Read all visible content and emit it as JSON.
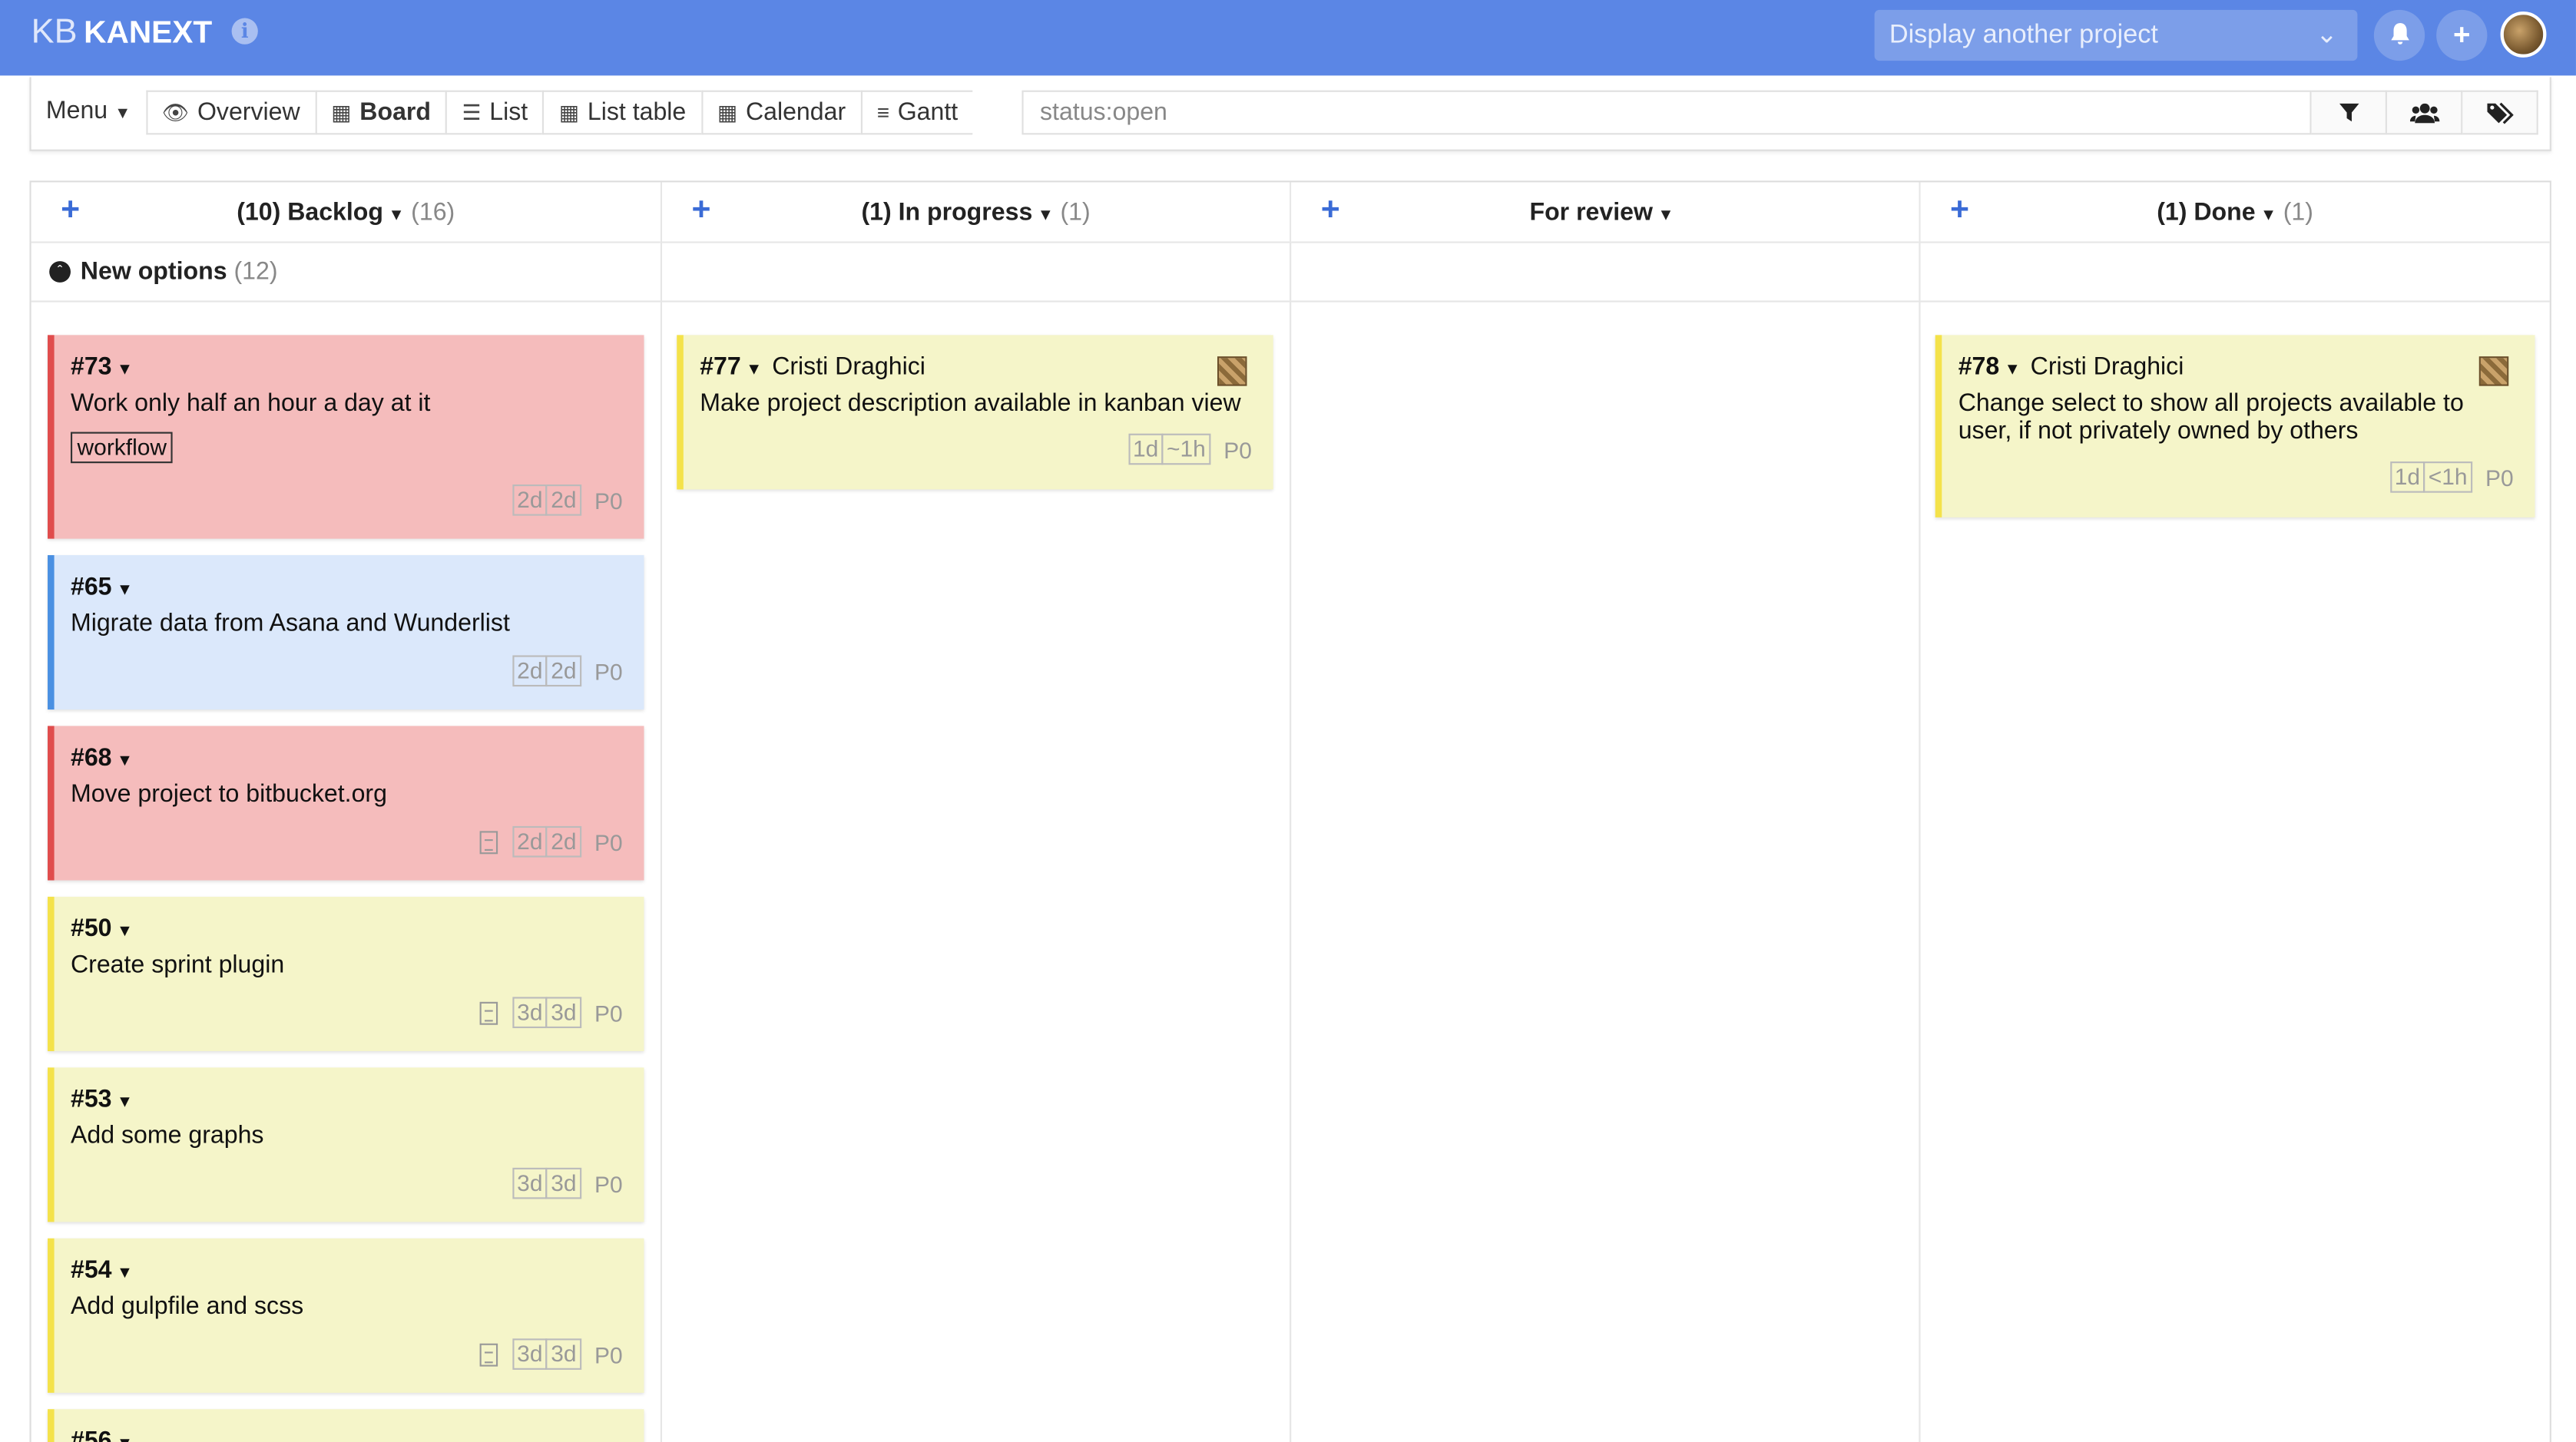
{
  "app": {
    "logo_prefix": "KB",
    "name": "KANEXT",
    "info_icon": "info-icon",
    "accent": "#5b86e5"
  },
  "header": {
    "project_selector": "Display another project",
    "icons": [
      "bell-icon",
      "plus-icon",
      "avatar"
    ]
  },
  "toolbar": {
    "menu_label": "Menu",
    "views": [
      {
        "label": "Overview",
        "icon": "eye-icon"
      },
      {
        "label": "Board",
        "icon": "grid-icon"
      },
      {
        "label": "List",
        "icon": "list-icon"
      },
      {
        "label": "List table",
        "icon": "table-icon"
      },
      {
        "label": "Calendar",
        "icon": "calendar-icon"
      },
      {
        "label": "Gantt",
        "icon": "sliders-icon"
      }
    ],
    "active_view": "Board",
    "search_value": "status:open",
    "filter_icons": [
      "filter-icon",
      "users-icon",
      "tags-icon"
    ]
  },
  "columns": [
    {
      "title": "(10) Backlog",
      "count": "(16)"
    },
    {
      "title": "(1) In progress",
      "count": "(1)"
    },
    {
      "title": "For review",
      "count": ""
    },
    {
      "title": "(1) Done",
      "count": "(1)"
    }
  ],
  "swimlane": {
    "title": "New options",
    "count": "(12)"
  },
  "cards": {
    "backlog": [
      {
        "id": "#73",
        "title": "Work only half an hour a day at it",
        "tag": "workflow",
        "est1": "2d",
        "est2": "2d",
        "priority": "P0",
        "color": "red"
      },
      {
        "id": "#65",
        "title": "Migrate data from Asana and Wunderlist",
        "est1": "2d",
        "est2": "2d",
        "priority": "P0",
        "color": "blue"
      },
      {
        "id": "#68",
        "title": "Move project to bitbucket.org",
        "est1": "2d",
        "est2": "2d",
        "priority": "P0",
        "color": "red"
      },
      {
        "id": "#50",
        "title": "Create sprint plugin",
        "est1": "3d",
        "est2": "3d",
        "priority": "P0",
        "color": "yellow"
      },
      {
        "id": "#53",
        "title": "Add some graphs",
        "est1": "3d",
        "est2": "3d",
        "priority": "P0",
        "color": "yellow"
      },
      {
        "id": "#54",
        "title": "Add gulpfile and scss",
        "est1": "3d",
        "est2": "3d",
        "priority": "P0",
        "color": "yellow"
      },
      {
        "id": "#56",
        "color": "yellow"
      }
    ],
    "in_progress": [
      {
        "id": "#77",
        "owner": "Cristi Draghici",
        "title": "Make project description available in kanban view",
        "est1": "1d",
        "est2": "~1h",
        "priority": "P0",
        "color": "yellow"
      }
    ],
    "done": [
      {
        "id": "#78",
        "owner": "Cristi Draghici",
        "title": "Change select to show all projects available to user, if not privately owned by others",
        "est1": "1d",
        "est2": "<1h",
        "priority": "P0",
        "color": "yellow"
      }
    ]
  },
  "colors": {
    "red_card": "#f5bcbc",
    "blue_card": "#dbe8fb",
    "yellow_card": "#f5f5c9",
    "plus": "#3a6bd6"
  }
}
